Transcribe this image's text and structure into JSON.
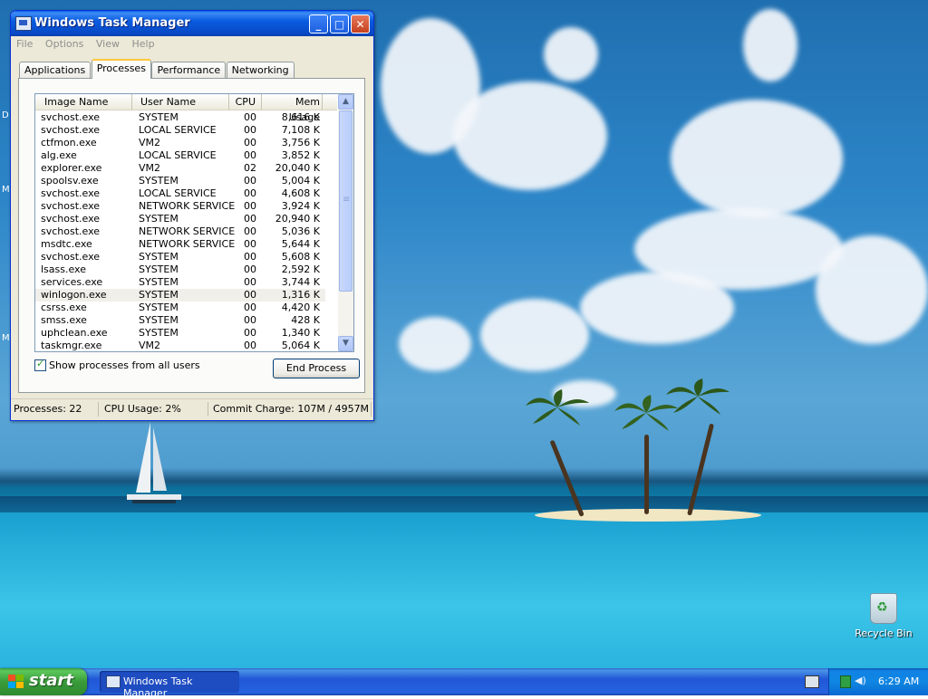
{
  "window": {
    "title": "Windows Task Manager",
    "menu": [
      "File",
      "Options",
      "View",
      "Help"
    ],
    "tabs": [
      "Applications",
      "Processes",
      "Performance",
      "Networking"
    ],
    "active_tab": "Processes"
  },
  "process_table": {
    "columns": [
      "Image Name",
      "User Name",
      "CPU",
      "Mem Usage"
    ],
    "rows": [
      {
        "name": "svchost.exe",
        "user": "SYSTEM",
        "cpu": "00",
        "mem": "8,616 K"
      },
      {
        "name": "svchost.exe",
        "user": "LOCAL SERVICE",
        "cpu": "00",
        "mem": "7,108 K"
      },
      {
        "name": "ctfmon.exe",
        "user": "VM2",
        "cpu": "00",
        "mem": "3,756 K"
      },
      {
        "name": "alg.exe",
        "user": "LOCAL SERVICE",
        "cpu": "00",
        "mem": "3,852 K"
      },
      {
        "name": "explorer.exe",
        "user": "VM2",
        "cpu": "02",
        "mem": "20,040 K"
      },
      {
        "name": "spoolsv.exe",
        "user": "SYSTEM",
        "cpu": "00",
        "mem": "5,004 K"
      },
      {
        "name": "svchost.exe",
        "user": "LOCAL SERVICE",
        "cpu": "00",
        "mem": "4,608 K"
      },
      {
        "name": "svchost.exe",
        "user": "NETWORK SERVICE",
        "cpu": "00",
        "mem": "3,924 K"
      },
      {
        "name": "svchost.exe",
        "user": "SYSTEM",
        "cpu": "00",
        "mem": "20,940 K"
      },
      {
        "name": "svchost.exe",
        "user": "NETWORK SERVICE",
        "cpu": "00",
        "mem": "5,036 K"
      },
      {
        "name": "msdtc.exe",
        "user": "NETWORK SERVICE",
        "cpu": "00",
        "mem": "5,644 K"
      },
      {
        "name": "svchost.exe",
        "user": "SYSTEM",
        "cpu": "00",
        "mem": "5,608 K"
      },
      {
        "name": "lsass.exe",
        "user": "SYSTEM",
        "cpu": "00",
        "mem": "2,592 K"
      },
      {
        "name": "services.exe",
        "user": "SYSTEM",
        "cpu": "00",
        "mem": "3,744 K"
      },
      {
        "name": "winlogon.exe",
        "user": "SYSTEM",
        "cpu": "00",
        "mem": "1,316 K"
      },
      {
        "name": "csrss.exe",
        "user": "SYSTEM",
        "cpu": "00",
        "mem": "4,420 K"
      },
      {
        "name": "smss.exe",
        "user": "SYSTEM",
        "cpu": "00",
        "mem": "428 K"
      },
      {
        "name": "uphclean.exe",
        "user": "SYSTEM",
        "cpu": "00",
        "mem": "1,340 K"
      },
      {
        "name": "taskmgr.exe",
        "user": "VM2",
        "cpu": "00",
        "mem": "5,064 K"
      }
    ]
  },
  "show_all_users": {
    "label": "Show processes from all users",
    "checked": true
  },
  "end_process_label": "End Process",
  "status": {
    "processes": "Processes: 22",
    "cpu_usage": "CPU Usage: 2%",
    "commit_charge": "Commit Charge: 107M / 4957M"
  },
  "desktop": {
    "recycle_bin_label": "Recycle Bin"
  },
  "taskbar": {
    "start_label": "start",
    "tasks": [
      "Windows Task Manager"
    ],
    "clock": "6:29 AM"
  },
  "colors": {
    "titlebar": "#0a5ce0",
    "start_button": "#3a9b3a",
    "taskbar": "#2157d7"
  },
  "icons": [
    "task-manager-icon",
    "minimize-icon",
    "maximize-icon",
    "close-icon",
    "recycle-bin-icon",
    "windows-flag-icon",
    "keyboard-icon",
    "network-icon",
    "speaker-icon"
  ]
}
